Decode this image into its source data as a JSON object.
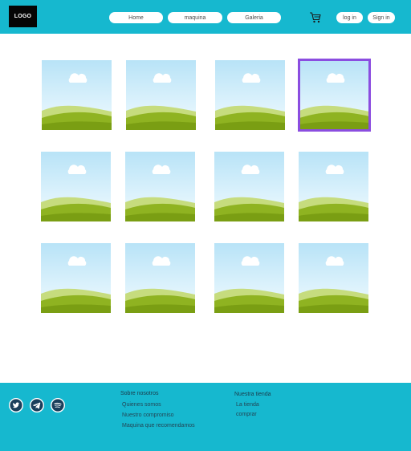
{
  "header": {
    "logo_text": "LOGO",
    "nav": [
      {
        "label": "Home"
      },
      {
        "label": "maquina"
      },
      {
        "label": "Galeria"
      }
    ],
    "cart_icon": "shopping-cart-icon",
    "login_label": "log in",
    "signin_label": "Sign in"
  },
  "gallery": {
    "image_icon": "landscape-placeholder-icon",
    "image_count": 12,
    "selected_index": 3,
    "selected_color": "#8b4de0"
  },
  "footer": {
    "social": [
      {
        "icon": "twitter-icon"
      },
      {
        "icon": "telegram-icon"
      },
      {
        "icon": "spotify-icon"
      }
    ],
    "about": {
      "heading": "Sobre nosotros",
      "links": [
        "Quienes somos",
        "Nuestro compromiso",
        "Maquina que recomendamos"
      ]
    },
    "store": {
      "heading": "Nuestra tienda",
      "links": [
        "La tienda",
        "comprar"
      ]
    }
  },
  "colors": {
    "accent": "#16b8cf",
    "logo_bg": "#050505",
    "page_bg": "#ffffff"
  }
}
